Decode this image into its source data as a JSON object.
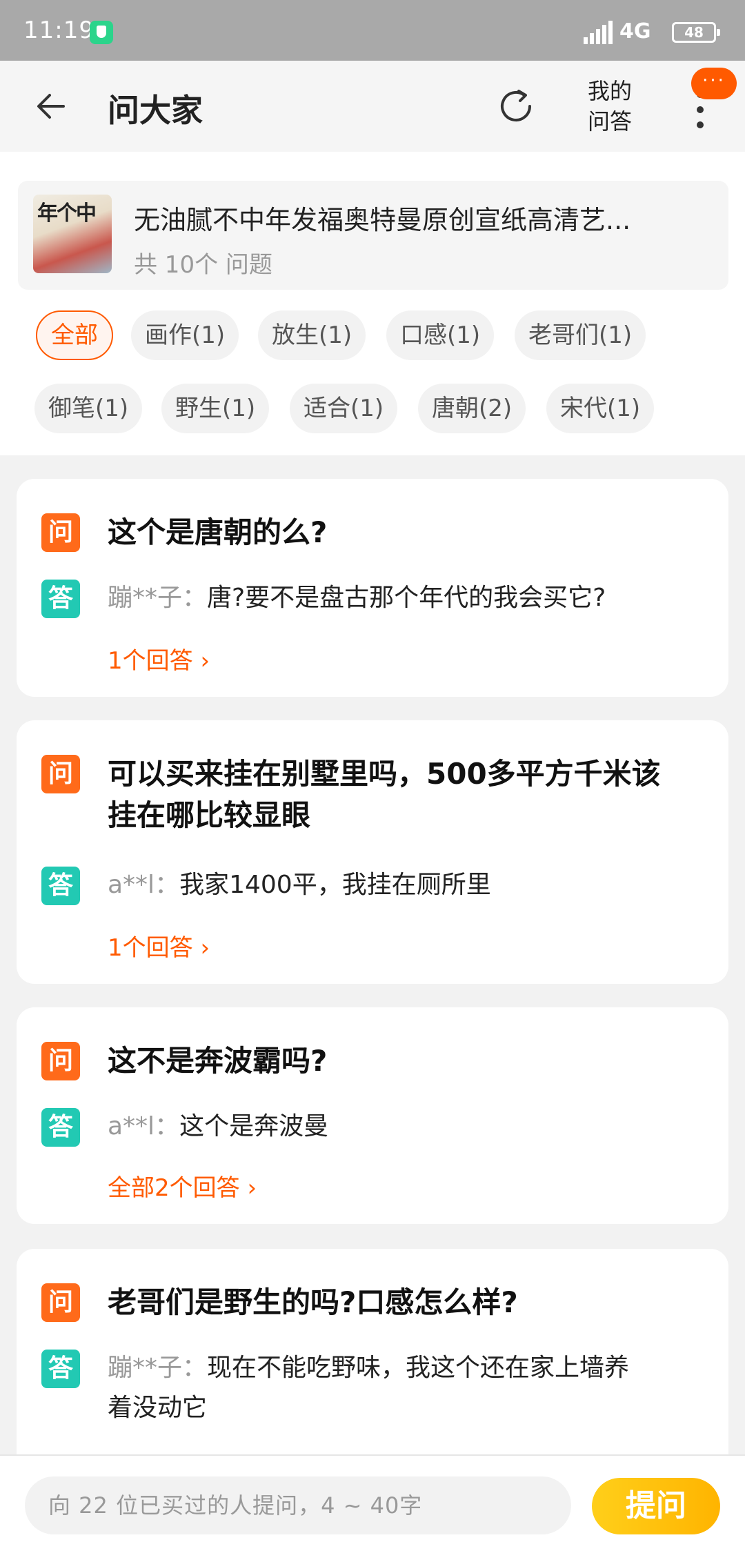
{
  "status_bar": {
    "time": "11:19",
    "network": "4G",
    "battery": "48"
  },
  "header": {
    "title": "问大家",
    "mine_label": "我的问答",
    "notif_badge": "···"
  },
  "product": {
    "name": "无油腻不中年发福奥特曼原创宣纸高清艺...",
    "question_count": "共 10个 问题",
    "thumb_text": "年个中"
  },
  "tags": [
    {
      "label": "全部"
    },
    {
      "label": "画作(1)"
    },
    {
      "label": "放生(1)"
    },
    {
      "label": "口感(1)"
    },
    {
      "label": "老哥们(1)"
    },
    {
      "label": "御笔(1)"
    },
    {
      "label": "野生(1)"
    },
    {
      "label": "适合(1)"
    },
    {
      "label": "唐朝(2)"
    },
    {
      "label": "宋代(1)"
    }
  ],
  "badges": {
    "question": "问",
    "answer": "答"
  },
  "questions": [
    {
      "question": "这个是唐朝的么?",
      "answer_user": "蹦**子：",
      "answer": "唐?要不是盘古那个年代的我会买它?",
      "answer_count": "1个回答"
    },
    {
      "question_line1": "可以买来挂在别墅里吗，500多平方千米该",
      "question_line2": "挂在哪比较显眼",
      "answer_user": "a**l：",
      "answer": "我家1400平，我挂在厕所里",
      "answer_count": "1个回答"
    },
    {
      "question": "这不是奔波霸吗?",
      "answer_user": "a**l：",
      "answer": "这个是奔波曼",
      "answer_count": "全部2个回答"
    },
    {
      "question": "老哥们是野生的吗?口感怎么样?",
      "answer_user": "蹦**子：",
      "answer": "现在不能吃野味，我这个还在家上墙养",
      "answer_line2": "着没动它"
    }
  ],
  "bottom": {
    "placeholder": "向  22  位已买过的人提问，4  ~  40字",
    "ask_button": "提问"
  },
  "colors": {
    "accent": "#ff5a00",
    "question_badge": "#ff6a1a",
    "answer_badge": "#22c9b3",
    "ask_button": "#ffbf00"
  }
}
